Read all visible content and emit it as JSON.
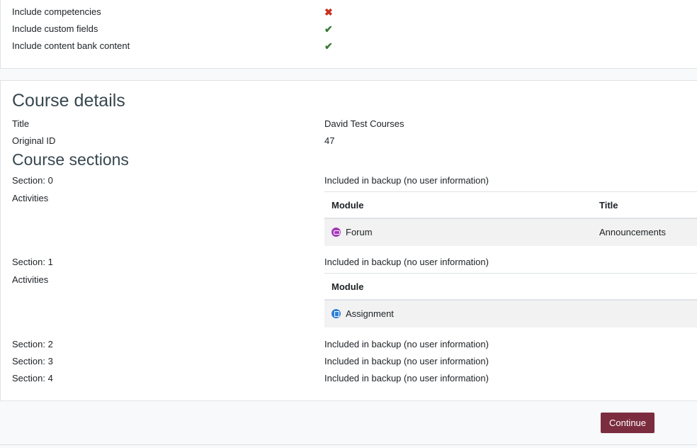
{
  "settings": [
    {
      "label": "Include competencies",
      "status": "cross"
    },
    {
      "label": "Include custom fields",
      "status": "check"
    },
    {
      "label": "Include content bank content",
      "status": "check"
    }
  ],
  "icons": {
    "cross": "✖",
    "check": "✔"
  },
  "course_details": {
    "heading": "Course details",
    "title_label": "Title",
    "title_value": "David Test Courses",
    "original_id_label": "Original ID",
    "original_id_value": "47"
  },
  "course_sections": {
    "heading": "Course sections",
    "section0": {
      "label": "Section: 0",
      "status": "Included in backup (no user information)",
      "activities_label": "Activities",
      "table": {
        "col_module": "Module",
        "col_title": "Title",
        "rows": [
          {
            "icon": "forum-icon",
            "module": "Forum",
            "title": "Announcements"
          }
        ]
      }
    },
    "section1": {
      "label": "Section: 1",
      "status": "Included in backup (no user information)",
      "activities_label": "Activities",
      "table": {
        "col_module": "Module",
        "rows": [
          {
            "icon": "assignment-icon",
            "module": "Assignment"
          }
        ]
      }
    },
    "section2": {
      "label": "Section: 2",
      "status": "Included in backup (no user information)"
    },
    "section3": {
      "label": "Section: 3",
      "status": "Included in backup (no user information)"
    },
    "section4": {
      "label": "Section: 4",
      "status": "Included in backup (no user information)"
    }
  },
  "footer": {
    "continue_label": "Continue"
  },
  "colors": {
    "primary_button": "#7b2d3f",
    "cross": "#ca3120",
    "check": "#357a32"
  }
}
